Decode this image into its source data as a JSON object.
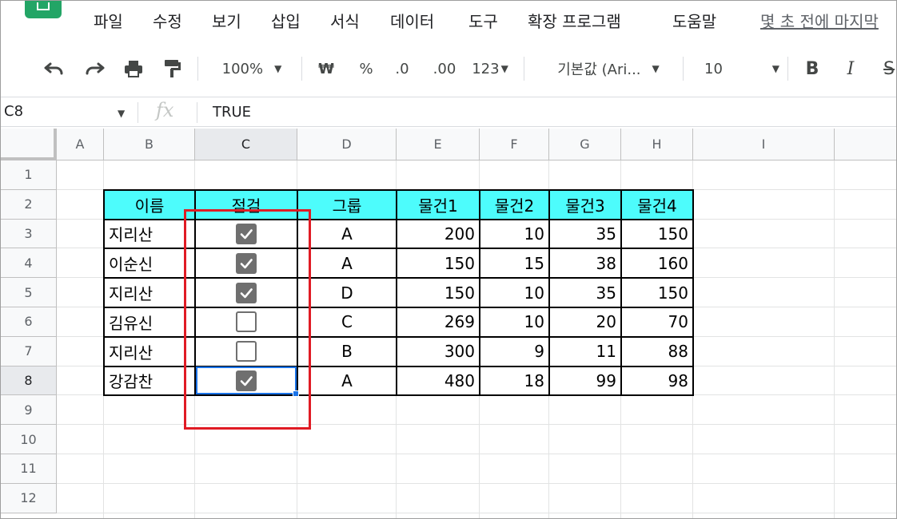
{
  "menu": {
    "items": [
      "파일",
      "수정",
      "보기",
      "삽입",
      "서식",
      "데이터",
      "도구",
      "확장 프로그램",
      "도움말"
    ],
    "last_edit": "몇 초 전에 마지막"
  },
  "toolbar": {
    "undo_icon": "undo-icon",
    "redo_icon": "redo-icon",
    "print_icon": "print-icon",
    "paint_format_icon": "paint-format-icon",
    "zoom": "100%",
    "currency": "₩",
    "percent": "%",
    "decrease_decimal": ".0",
    "increase_decimal": ".00",
    "number_format": "123",
    "font": "기본값 (Ari...",
    "font_size": "10",
    "bold": "B",
    "italic": "I",
    "strike": "S"
  },
  "formula_bar": {
    "name_box": "C8",
    "fx": "fx",
    "value": "TRUE"
  },
  "columns": [
    "A",
    "B",
    "C",
    "D",
    "E",
    "F",
    "G",
    "H",
    "I"
  ],
  "rows": [
    "1",
    "2",
    "3",
    "4",
    "5",
    "6",
    "7",
    "8",
    "9",
    "10",
    "11",
    "12"
  ],
  "selected_column": "C",
  "selected_row": "8",
  "table": {
    "headers": [
      "이름",
      "점검",
      "그룹",
      "물건1",
      "물건2",
      "물건3",
      "물건4"
    ],
    "rows": [
      {
        "name": "지리산",
        "checked": true,
        "group": "A",
        "v1": "200",
        "v2": "10",
        "v3": "35",
        "v4": "150"
      },
      {
        "name": "이순신",
        "checked": true,
        "group": "A",
        "v1": "150",
        "v2": "15",
        "v3": "38",
        "v4": "160"
      },
      {
        "name": "지리산",
        "checked": true,
        "group": "D",
        "v1": "150",
        "v2": "10",
        "v3": "35",
        "v4": "150"
      },
      {
        "name": "김유신",
        "checked": false,
        "group": "C",
        "v1": "269",
        "v2": "10",
        "v3": "20",
        "v4": "70"
      },
      {
        "name": "지리산",
        "checked": false,
        "group": "B",
        "v1": "300",
        "v2": "9",
        "v3": "11",
        "v4": "88"
      },
      {
        "name": "강감찬",
        "checked": true,
        "group": "A",
        "v1": "480",
        "v2": "18",
        "v3": "99",
        "v4": "98"
      }
    ]
  },
  "colors": {
    "header_fill": "#4dfcfc",
    "highlight": "#e01b24",
    "selection": "#1a73e8",
    "checkbox": "#6f6f6f"
  }
}
